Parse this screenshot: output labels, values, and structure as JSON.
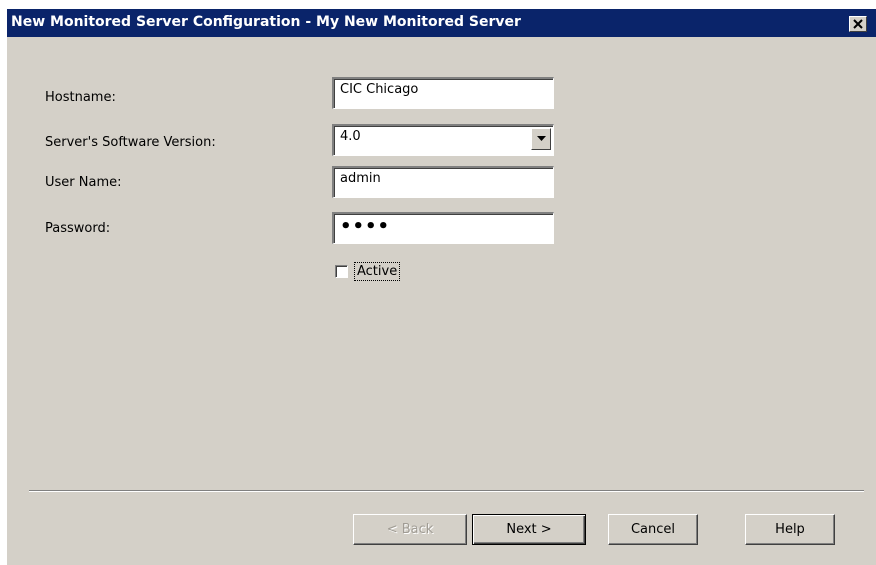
{
  "window": {
    "title": "New Monitored Server Configuration - My New Monitored Server",
    "close_glyph": "✕"
  },
  "form": {
    "hostname_label": "Hostname:",
    "hostname_value": "CIC Chicago",
    "version_label": "Server's Software Version:",
    "version_value": "4.0",
    "username_label": "User Name:",
    "username_value": "admin",
    "password_label": "Password:",
    "password_value": "••••",
    "active_label": "Active",
    "active_checked": false
  },
  "buttons": {
    "back": "< Back",
    "next": "Next >",
    "cancel": "Cancel",
    "help": "Help"
  },
  "icons": {
    "close": "close-icon",
    "dropdown": "chevron-down-icon"
  },
  "colors": {
    "titlebar": "#0a246a",
    "dialog_bg": "#d4d0c8"
  }
}
